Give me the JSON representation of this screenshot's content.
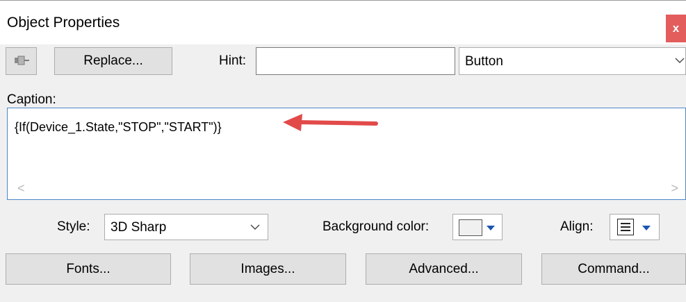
{
  "window": {
    "title": "Object Properties",
    "close_label": "x"
  },
  "toolbar": {
    "pin_icon": "pin-icon",
    "replace_label": "Replace...",
    "hint_label": "Hint:",
    "hint_value": "",
    "type_value": "Button"
  },
  "caption": {
    "label": "Caption:",
    "value": "{If(Device_1.State,\"STOP\",\"START\")}",
    "scroll_left": "<",
    "scroll_right": ">"
  },
  "options": {
    "style_label": "Style:",
    "style_value": "3D Sharp",
    "bg_color_label": "Background color:",
    "bg_color_value": "#f0f0f0",
    "align_label": "Align:"
  },
  "buttons": {
    "fonts": "Fonts...",
    "images": "Images...",
    "advanced": "Advanced...",
    "command": "Command..."
  },
  "colors": {
    "close": "#e35d5d",
    "accent_border": "#4a86c8",
    "annotation_arrow": "#e24a4a",
    "dropdown_arrow": "#1a56b0"
  }
}
